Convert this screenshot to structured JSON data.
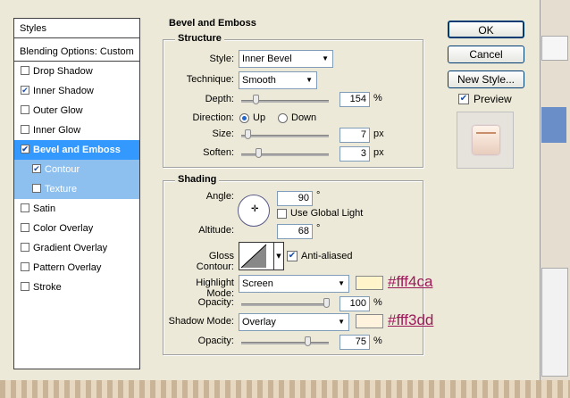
{
  "styles_panel": {
    "header": "Styles",
    "blending": "Blending Options: Custom",
    "items": [
      {
        "label": "Drop Shadow",
        "checked": false
      },
      {
        "label": "Inner Shadow",
        "checked": true
      },
      {
        "label": "Outer Glow",
        "checked": false
      },
      {
        "label": "Inner Glow",
        "checked": false
      },
      {
        "label": "Bevel and Emboss",
        "checked": true,
        "selected": true
      },
      {
        "label": "Contour",
        "checked": true,
        "sub": true
      },
      {
        "label": "Texture",
        "checked": false,
        "sub": true
      },
      {
        "label": "Satin",
        "checked": false
      },
      {
        "label": "Color Overlay",
        "checked": false
      },
      {
        "label": "Gradient Overlay",
        "checked": false
      },
      {
        "label": "Pattern Overlay",
        "checked": false
      },
      {
        "label": "Stroke",
        "checked": false
      }
    ]
  },
  "bevel": {
    "title": "Bevel and Emboss",
    "structure_title": "Structure",
    "style_label": "Style:",
    "style_value": "Inner Bevel",
    "technique_label": "Technique:",
    "technique_value": "Smooth",
    "depth_label": "Depth:",
    "depth_value": "154",
    "depth_unit": "%",
    "direction_label": "Direction:",
    "direction_up": "Up",
    "direction_down": "Down",
    "size_label": "Size:",
    "size_value": "7",
    "size_unit": "px",
    "soften_label": "Soften:",
    "soften_value": "3",
    "soften_unit": "px"
  },
  "shading": {
    "title": "Shading",
    "angle_label": "Angle:",
    "angle_value": "90",
    "angle_unit": "°",
    "global_light_label": "Use Global Light",
    "global_light_checked": false,
    "altitude_label": "Altitude:",
    "altitude_value": "68",
    "altitude_unit": "°",
    "gloss_label": "Gloss Contour:",
    "anti_aliased_label": "Anti-aliased",
    "anti_aliased_checked": true,
    "highlight_mode_label": "Highlight Mode:",
    "highlight_mode_value": "Screen",
    "highlight_color": "#fff4ca",
    "highlight_hex": "#fff4ca",
    "opacity1_label": "Opacity:",
    "opacity1_value": "100",
    "opacity1_unit": "%",
    "shadow_mode_label": "Shadow Mode:",
    "shadow_mode_value": "Overlay",
    "shadow_color": "#fff3dd",
    "shadow_hex": "#fff3dd",
    "opacity2_label": "Opacity:",
    "opacity2_value": "75",
    "opacity2_unit": "%"
  },
  "buttons": {
    "ok": "OK",
    "cancel": "Cancel",
    "new_style": "New Style...",
    "preview_label": "Preview",
    "preview_checked": true
  }
}
